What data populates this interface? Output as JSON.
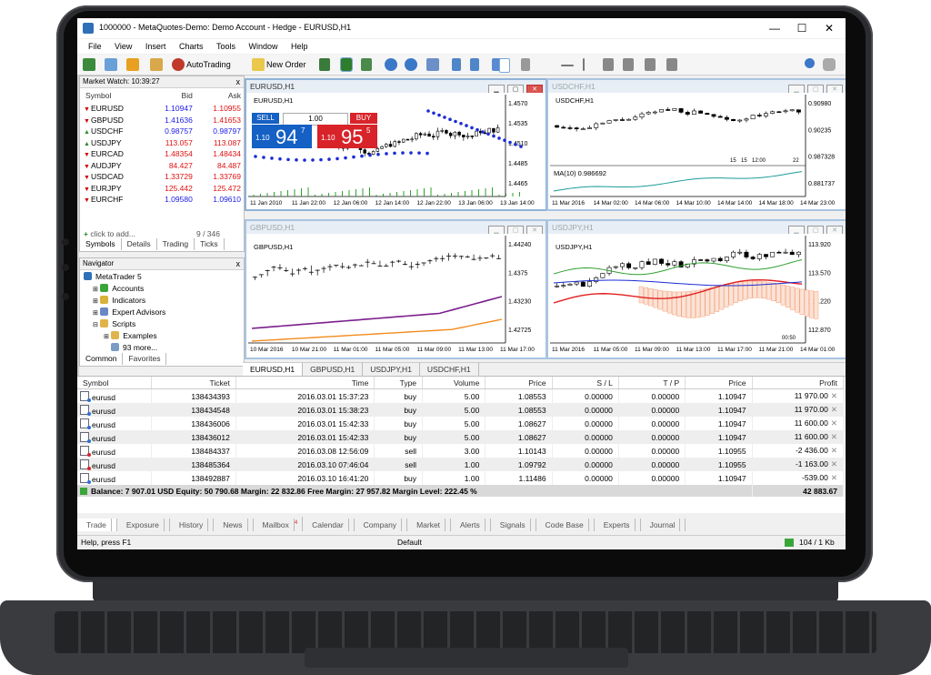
{
  "window": {
    "title": "1000000 - MetaQuotes-Demo: Demo Account - Hedge - EURUSD,H1",
    "minimize": "—",
    "maximize": "☐",
    "close": "✕"
  },
  "menu": [
    "File",
    "View",
    "Insert",
    "Charts",
    "Tools",
    "Window",
    "Help"
  ],
  "toolbar": {
    "autotrading": "AutoTrading",
    "new_order": "New Order"
  },
  "market_watch": {
    "title": "Market Watch: 10:39:27",
    "close": "x",
    "headers": {
      "symbol": "Symbol",
      "bid": "Bid",
      "ask": "Ask"
    },
    "rows": [
      {
        "symbol": "EURUSD",
        "bid": "1.10947",
        "ask": "1.10955",
        "dir": "down"
      },
      {
        "symbol": "GBPUSD",
        "bid": "1.41636",
        "ask": "1.41653",
        "dir": "down"
      },
      {
        "symbol": "USDCHF",
        "bid": "0.98757",
        "ask": "0.98797",
        "dir": "up"
      },
      {
        "symbol": "USDJPY",
        "bid": "113.057",
        "ask": "113.087",
        "dir": "up"
      },
      {
        "symbol": "EURCAD",
        "bid": "1.48354",
        "ask": "1.48434",
        "dir": "down"
      },
      {
        "symbol": "AUDJPY",
        "bid": "84.427",
        "ask": "84.487",
        "dir": "down"
      },
      {
        "symbol": "USDCAD",
        "bid": "1.33729",
        "ask": "1.33769",
        "dir": "down"
      },
      {
        "symbol": "EURJPY",
        "bid": "125.442",
        "ask": "125.472",
        "dir": "down"
      },
      {
        "symbol": "EURCHF",
        "bid": "1.09580",
        "ask": "1.09610",
        "dir": "down"
      }
    ],
    "add": "click to add...",
    "count": "9 / 346",
    "tabs": [
      "Symbols",
      "Details",
      "Trading",
      "Ticks"
    ]
  },
  "navigator": {
    "title": "Navigator",
    "close": "x",
    "items": [
      "MetaTrader 5",
      "Accounts",
      "Indicators",
      "Expert Advisors",
      "Scripts",
      "Examples",
      "93 more..."
    ],
    "tabs": [
      "Common",
      "Favorites"
    ]
  },
  "charts": [
    {
      "title": "EURUSD,H1",
      "label": "EURUSD,H1",
      "prices": [
        "1.4570",
        "1.4535",
        "1.4510",
        "1.4485",
        "1.4465"
      ],
      "times": [
        "11 Jan 2010",
        "11 Jan 22:00",
        "12 Jan 06:00",
        "12 Jan 14:00",
        "12 Jan 22:00",
        "13 Jan 06:00",
        "13 Jan 14:00"
      ],
      "trade": {
        "sell": "SELL",
        "buy": "BUY",
        "lot": "1.00",
        "bid_small": "1.10",
        "bid_big": "94",
        "bid_sup": "7",
        "ask_small": "1.10",
        "ask_big": "95",
        "ask_sup": "5"
      }
    },
    {
      "title": "USDCHF,H1",
      "label": "USDCHF,H1",
      "prices": [
        "0.90980",
        "0.90235",
        "0.987328",
        "0.881737"
      ],
      "times": [
        "11 Mar 2016",
        "14 Mar 02:00",
        "14 Mar 06:00",
        "14 Mar 10:00",
        "14 Mar 14:00",
        "14 Mar 18:00",
        "14 Mar 23:00"
      ],
      "indicator": "MA(10) 0.986692",
      "sub_labels": [
        "15",
        "15",
        "12:00",
        "22"
      ]
    },
    {
      "title": "GBPUSD,H1",
      "label": "GBPUSD,H1",
      "prices": [
        "1.44240",
        "1.4375",
        "1.43230",
        "1.42725"
      ],
      "times": [
        "10 Mar 2016",
        "10 Mar 21:00",
        "11 Mar 01:00",
        "11 Mar 05:00",
        "11 Mar 09:00",
        "11 Mar 13:00",
        "11 Mar 17:00"
      ]
    },
    {
      "title": "USDJPY,H1",
      "label": "USDJPY,H1",
      "prices": [
        "113.920",
        "113.570",
        "113.220",
        "112.870"
      ],
      "times": [
        "11 Mar 2016",
        "11 Mar 05:00",
        "11 Mar 09:00",
        "11 Mar 13:00",
        "11 Mar 17:00",
        "11 Mar 21:00",
        "14 Mar 01:00"
      ],
      "sub_labels": [
        "00:50"
      ]
    }
  ],
  "chart_tabs": [
    "EURUSD,H1",
    "GBPUSD,H1",
    "USDJPY,H1",
    "USDCHF,H1"
  ],
  "trade_table": {
    "headers": [
      "Symbol",
      "Ticket",
      "Time",
      "Type",
      "Volume",
      "Price",
      "S / L",
      "T / P",
      "Price",
      "Profit"
    ],
    "rows": [
      {
        "symbol": "eurusd",
        "ticket": "138434393",
        "time": "2016.03.01 15:37:23",
        "type": "buy",
        "volume": "5.00",
        "price": "1.08553",
        "sl": "0.00000",
        "tp": "0.00000",
        "cur": "1.10947",
        "profit": "11 970.00"
      },
      {
        "symbol": "eurusd",
        "ticket": "138434548",
        "time": "2016.03.01 15:38:23",
        "type": "buy",
        "volume": "5.00",
        "price": "1.08553",
        "sl": "0.00000",
        "tp": "0.00000",
        "cur": "1.10947",
        "profit": "11 970.00"
      },
      {
        "symbol": "eurusd",
        "ticket": "138436006",
        "time": "2016.03.01 15:42:33",
        "type": "buy",
        "volume": "5.00",
        "price": "1.08627",
        "sl": "0.00000",
        "tp": "0.00000",
        "cur": "1.10947",
        "profit": "11 600.00"
      },
      {
        "symbol": "eurusd",
        "ticket": "138436012",
        "time": "2016.03.01 15:42:33",
        "type": "buy",
        "volume": "5.00",
        "price": "1.08627",
        "sl": "0.00000",
        "tp": "0.00000",
        "cur": "1.10947",
        "profit": "11 600.00"
      },
      {
        "symbol": "eurusd",
        "ticket": "138484337",
        "time": "2016.03.08 12:56:09",
        "type": "sell",
        "volume": "3.00",
        "price": "1.10143",
        "sl": "0.00000",
        "tp": "0.00000",
        "cur": "1.10955",
        "profit": "-2 436.00"
      },
      {
        "symbol": "eurusd",
        "ticket": "138485364",
        "time": "2016.03.10 07:46:04",
        "type": "sell",
        "volume": "1.00",
        "price": "1.09792",
        "sl": "0.00000",
        "tp": "0.00000",
        "cur": "1.10955",
        "profit": "-1 163.00"
      },
      {
        "symbol": "eurusd",
        "ticket": "138492887",
        "time": "2016.03.10 16:41:20",
        "type": "buy",
        "volume": "1.00",
        "price": "1.11486",
        "sl": "0.00000",
        "tp": "0.00000",
        "cur": "1.10947",
        "profit": "-539.00"
      }
    ],
    "balance": "Balance: 7 907.01 USD  Equity: 50 790.68  Margin: 22 832.86  Free Margin: 27 957.82  Margin Level: 222.45 %",
    "total": "42 883.67"
  },
  "terminal_tabs": [
    "Trade",
    "Exposure",
    "History",
    "News",
    "Mailbox",
    "Calendar",
    "Company",
    "Market",
    "Alerts",
    "Signals",
    "Code Base",
    "Experts",
    "Journal"
  ],
  "mailbox_badge": "4",
  "status": {
    "help": "Help, press F1",
    "profile": "Default",
    "traffic": "104 / 1 Kb"
  },
  "colors": {
    "bid_blue": "#1460c4",
    "ask_red": "#d8232a",
    "profit_up": "#2e8b2e"
  }
}
